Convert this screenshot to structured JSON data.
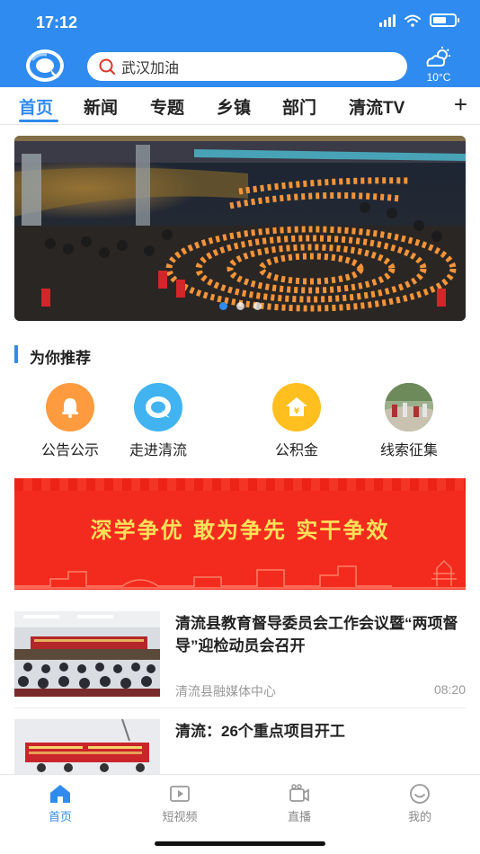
{
  "status": {
    "time": "17:12"
  },
  "search": {
    "text": "武汉加油"
  },
  "weather": {
    "temp": "10°C"
  },
  "tabs": [
    {
      "label": "首页",
      "active": true
    },
    {
      "label": "新闻"
    },
    {
      "label": "专题"
    },
    {
      "label": "乡镇"
    },
    {
      "label": "部门"
    },
    {
      "label": "清流TV"
    }
  ],
  "tabs_more": "+",
  "banner": {
    "slides": 3,
    "active_slide": 0
  },
  "recommend": {
    "title": "为你推荐",
    "items": [
      {
        "label": "公告公示",
        "icon": "bell-icon"
      },
      {
        "label": "走进清流",
        "icon": "qingliu-logo-icon"
      },
      {
        "label": "公积金",
        "icon": "house-yuan-icon"
      },
      {
        "label": "线索征集",
        "icon": "photo-thumbnail"
      }
    ]
  },
  "slogan": {
    "text": "深学争优  敢为争先  实干争效"
  },
  "news": [
    {
      "title": "清流县教育督导委员会工作会议暨“两项督导”迎检动员会召开",
      "source": "清流县融媒体中心",
      "time": "08:20"
    },
    {
      "title": "清流：26个重点项目开工",
      "source": "",
      "time": ""
    }
  ],
  "bottom_nav": [
    {
      "label": "首页",
      "icon": "home-icon",
      "active": true
    },
    {
      "label": "短视频",
      "icon": "video-icon"
    },
    {
      "label": "直播",
      "icon": "live-camera-icon"
    },
    {
      "label": "我的",
      "icon": "smile-icon"
    }
  ],
  "colors": {
    "primary": "#2f8bef",
    "slogan_bg": "#f32b1e",
    "slogan_text": "#ffe15a"
  }
}
